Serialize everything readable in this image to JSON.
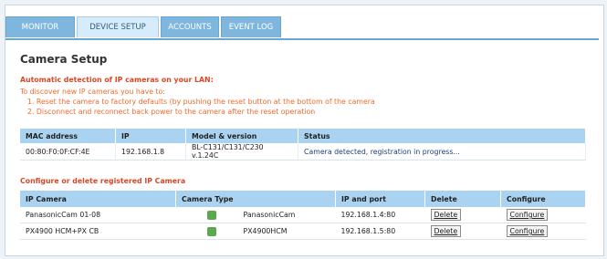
{
  "tabs": [
    {
      "label": "MONITOR"
    },
    {
      "label": "DEVICE SETUP"
    },
    {
      "label": "ACCOUNTS"
    },
    {
      "label": "EVENT LOG"
    }
  ],
  "page_title": "Camera Setup",
  "auto_detect_title": "Automatic detection of IP cameras on your LAN:",
  "instructions": {
    "intro": "To discover new IP cameras you have to:",
    "step1": "1. Reset the camera to factory defaults (by pushing the reset button at the bottom of the camera",
    "step2": "2. Disconnect and reconnect back power to the camera after the reset operation"
  },
  "detect_table": {
    "headers": [
      "MAC address",
      "IP",
      "Model & version",
      "Status"
    ],
    "rows": [
      [
        "00:80:F0:0F:CF:4E",
        "192.168.1.8",
        "BL-C131/C131/C230 v.1.24C",
        "Camera detected, registration in progress..."
      ]
    ]
  },
  "registered_title": "Configure or delete registered IP Camera",
  "reg_table": {
    "headers": [
      "IP Camera",
      "Camera Type",
      "IP and port",
      "Delete",
      "Configure"
    ],
    "rows": [
      {
        "name": "PanasonicCam 01-08",
        "type": "PanasonicCam",
        "ip": "192.168.1.4:80",
        "delete": "Delete",
        "configure": "Configure"
      },
      {
        "name": "PX4900 HCM+PX CB",
        "type": "PX4900HCM",
        "ip": "192.168.1.5:80",
        "delete": "Delete",
        "configure": "Configure"
      }
    ]
  },
  "colors": {
    "accent": "#7fb6dd",
    "header_bg": "#a9d3f0",
    "alert": "#d84726"
  }
}
